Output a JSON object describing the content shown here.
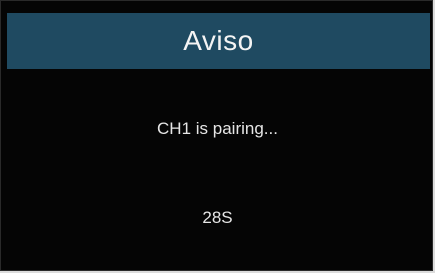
{
  "dialog": {
    "title": "Aviso",
    "message": "CH1 is pairing...",
    "countdown": "28S"
  },
  "colors": {
    "titlebar": "#1f4a61",
    "background": "#050505",
    "text": "#e6e6e6"
  }
}
